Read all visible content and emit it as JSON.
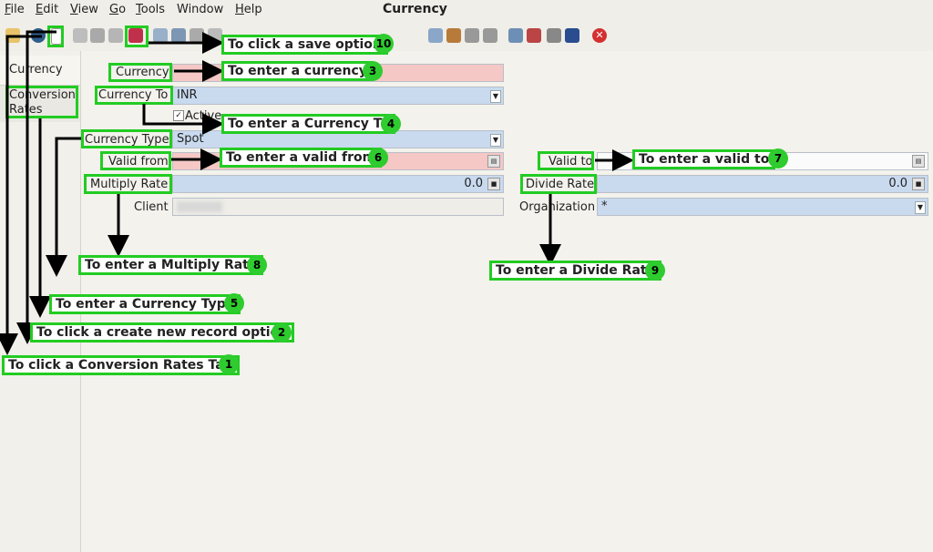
{
  "menu": {
    "file": {
      "u": "F",
      "rest": "ile"
    },
    "edit": {
      "u": "E",
      "rest": "dit"
    },
    "view": {
      "u": "V",
      "rest": "iew"
    },
    "go": {
      "u": "G",
      "rest": "o"
    },
    "tools": {
      "u": "T",
      "rest": "ools"
    },
    "window": "Window",
    "help": {
      "u": "H",
      "rest": "elp"
    }
  },
  "window_title": "Currency",
  "tabs": {
    "currency": "Currency",
    "conversion_rates_1": "Conversion",
    "conversion_rates_2": "Rates"
  },
  "form": {
    "currency_label": "Currency",
    "currency_value": "",
    "currency_to_label": "Currency To",
    "currency_to_value": "INR",
    "active_label": "Active",
    "currency_type_label": "Currency Type",
    "currency_type_value": "Spot",
    "valid_from_label": "Valid from",
    "valid_to_label": "Valid to",
    "multiply_rate_label": "Multiply Rate",
    "multiply_rate_value": "0.0",
    "divide_rate_label": "Divide Rate",
    "divide_rate_value": "0.0",
    "client_label": "Client",
    "organization_label": "Organization",
    "organization_value": "*"
  },
  "annotations": {
    "a1": {
      "text": "To click a Conversion Rates Tab",
      "num": "1"
    },
    "a2": {
      "text": "To click a create new record option",
      "num": "2"
    },
    "a3": {
      "text": "To enter a currency",
      "num": "3"
    },
    "a4": {
      "text": "To enter a Currency To",
      "num": "4"
    },
    "a5": {
      "text": "To enter a Currency Type",
      "num": "5"
    },
    "a6": {
      "text": "To enter a valid from",
      "num": "6"
    },
    "a7": {
      "text": "To enter a valid to",
      "num": "7"
    },
    "a8": {
      "text": "To enter a Multiply Rate",
      "num": "8"
    },
    "a9": {
      "text": "To enter a Divide Rate",
      "num": "9"
    },
    "a10": {
      "text": "To click a save option",
      "num": "10"
    }
  },
  "colors": {
    "mandatory": "#f5c7c5",
    "optional": "#c9daef",
    "annotation_border": "#22cc22"
  }
}
